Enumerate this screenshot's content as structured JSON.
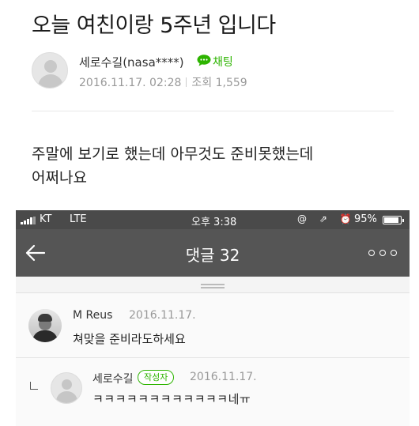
{
  "post": {
    "title": "오늘 여친이랑 5주년 입니다",
    "author": "세로수길(nasa****)",
    "chat_label": "채팅",
    "date": "2016.11.17. 02:28",
    "views": "조회 1,559",
    "body_line1": "주말에 보기로 했는데 아무것도 준비못했는데",
    "body_line2": "어쩌나요"
  },
  "phone": {
    "status": {
      "carrier": "KT",
      "network": "LTE",
      "time": "오후 3:38",
      "icons": "@ ⇗ ⏰",
      "battery": "95%"
    },
    "nav": {
      "title": "댓글 32",
      "back_icon": "back-arrow-icon",
      "more_icon": "more-options-icon"
    },
    "comments": [
      {
        "name": "M Reus",
        "date": "2016.11.17.",
        "text": "쳐맞을 준비라도하세요",
        "avatar": "profile-photo"
      }
    ],
    "reply": {
      "name": "세로수길",
      "badge": "작성자",
      "date": "2016.11.17.",
      "text": "ㅋㅋㅋㅋㅋㅋㅋㅋㅋㅋㅋㅋ네ㅠ"
    }
  },
  "colors": {
    "accent_green": "#2db400",
    "status_bar": "#4a4a4a",
    "nav_bar": "#555555"
  }
}
